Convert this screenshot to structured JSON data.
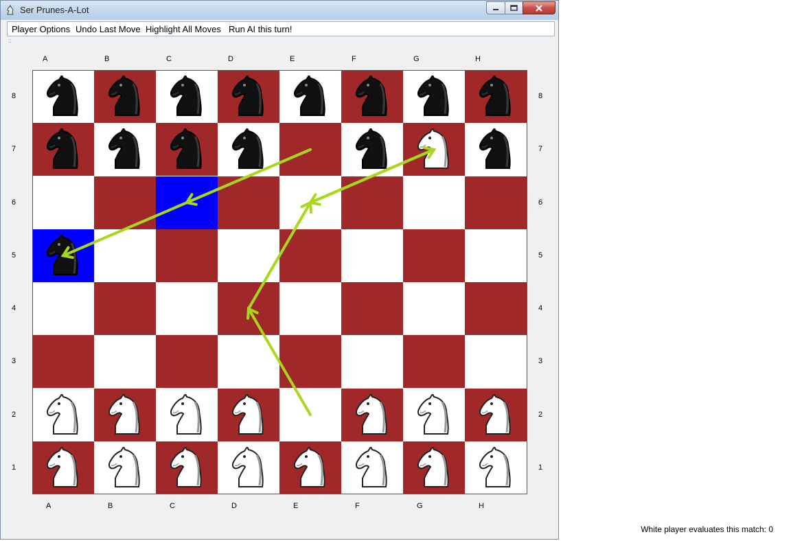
{
  "window": {
    "title": "Ser Prunes-A-Lot"
  },
  "menu": [
    {
      "label": "Player Options"
    },
    {
      "label": "Undo Last Move"
    },
    {
      "label": "Highlight All Moves"
    },
    {
      "label": "Run AI this turn!"
    }
  ],
  "board": {
    "files": [
      "A",
      "B",
      "C",
      "D",
      "E",
      "F",
      "G",
      "H"
    ],
    "ranks": [
      "8",
      "7",
      "6",
      "5",
      "4",
      "3",
      "2",
      "1"
    ],
    "highlighted_squares": [
      "C6",
      "A5"
    ],
    "pieces": {
      "A8": "black-knight",
      "B8": "black-knight",
      "C8": "black-knight",
      "D8": "black-knight",
      "E8": "black-knight",
      "F8": "black-knight",
      "G8": "black-knight",
      "H8": "black-knight",
      "A7": "black-knight",
      "B7": "black-knight",
      "C7": "black-knight",
      "D7": "black-knight",
      "F7": "black-knight",
      "G7": "white-knight",
      "H7": "black-knight",
      "A5": "black-knight",
      "A2": "white-knight",
      "B2": "white-knight",
      "C2": "white-knight",
      "D2": "white-knight",
      "F2": "white-knight",
      "G2": "white-knight",
      "H2": "white-knight",
      "A1": "white-knight",
      "B1": "white-knight",
      "C1": "white-knight",
      "D1": "white-knight",
      "E1": "white-knight",
      "F1": "white-knight",
      "G1": "white-knight",
      "H1": "white-knight"
    },
    "colors": {
      "dark": "#a02828",
      "light": "#ffffff",
      "highlight": "#0000ff",
      "annotation": "#a8d81e"
    }
  },
  "annotations": [
    {
      "from": "E7",
      "to": "C6"
    },
    {
      "from": "C6",
      "to": "A5"
    },
    {
      "from": "G7",
      "to": "E6"
    },
    {
      "from": "E2",
      "to": "D4"
    },
    {
      "from": "D4",
      "to": "E6"
    },
    {
      "from": "E6",
      "to": "G7"
    }
  ],
  "status": {
    "text": "White player evaluates this match: 0"
  }
}
